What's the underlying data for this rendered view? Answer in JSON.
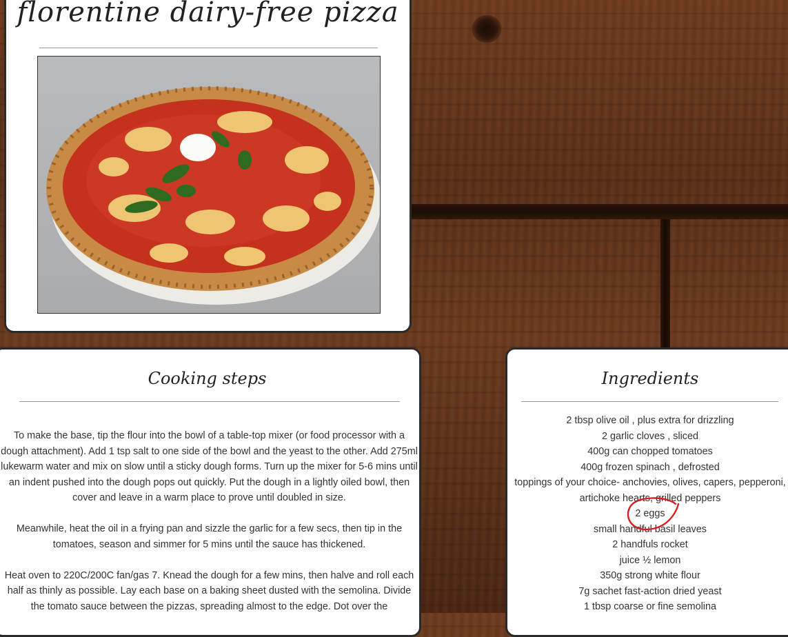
{
  "recipe": {
    "title": "florentine dairy-free pizza",
    "image_alt": "Margherita pizza with basil and mozzarella on a plate"
  },
  "steps": {
    "heading": "Cooking steps",
    "paragraphs": [
      "To make the base, tip the flour into the bowl of a table-top mixer (or food processor with a dough attachment). Add 1 tsp salt to one side of the bowl and the yeast to the other. Add 275ml lukewarm water and mix on slow until a sticky dough forms. Turn up the mixer for 5-6 mins until an indent pushed into the dough pops out quickly. Put the dough in a lightly oiled bowl, then cover and leave in a warm place to prove until doubled in size.",
      "Meanwhile, heat the oil in a frying pan and sizzle the garlic for a few secs, then tip in the tomatoes, season and simmer for 5 mins until the sauce has thickened.",
      "Heat oven to 220C/200C fan/gas 7. Knead the dough for a few mins, then halve and roll each half as thinly as possible. Lay each base on a baking sheet dusted with the semolina. Divide the tomato sauce between the pizzas, spreading almost to the edge. Dot over the"
    ]
  },
  "ingredients": {
    "heading": "Ingredients",
    "items": [
      "2 tbsp olive oil , plus extra for drizzling",
      "2 garlic cloves , sliced",
      "400g can chopped tomatoes",
      "400g frozen spinach , defrosted",
      "toppings of your choice- anchovies, olives, capers, pepperoni, artichoke hearts, grilled peppers",
      "2 eggs",
      "small handful basil leaves",
      "2 handfuls rocket",
      "juice ½ lemon",
      "350g strong white flour",
      "7g sachet fast-action dried yeast",
      "1 tbsp coarse or fine semolina"
    ]
  },
  "annotation": {
    "color": "#d42020",
    "target": "2 eggs"
  }
}
